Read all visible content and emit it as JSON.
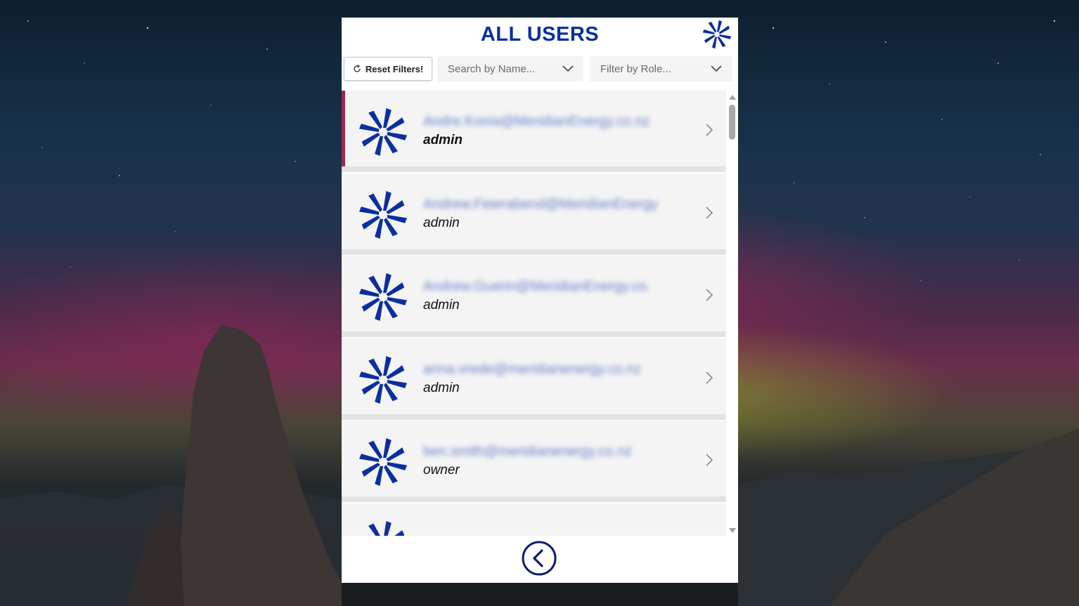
{
  "header": {
    "title": "ALL USERS",
    "logo_icon": "meridian-pinwheel-icon"
  },
  "filters": {
    "reset_label": "Reset Filters!",
    "reset_icon": "refresh-icon",
    "search_placeholder": "Search by Name...",
    "role_placeholder": "Filter by Role..."
  },
  "users": [
    {
      "email": "Andre.Konia@MeridianEnergy.co.nz",
      "role": "admin",
      "selected": true
    },
    {
      "email": "Andrew.Feierabend@MeridianEnergy",
      "role": "admin",
      "selected": false
    },
    {
      "email": "Andrew.Guerin@MeridianEnergy.co.",
      "role": "admin",
      "selected": false
    },
    {
      "email": "anna.vrede@meridianenergy.co.nz",
      "role": "admin",
      "selected": false
    },
    {
      "email": "ben.smith@meridianenergy.co.nz",
      "role": "owner",
      "selected": false
    },
    {
      "email": "",
      "role": "",
      "selected": false
    }
  ],
  "footer": {
    "back_icon": "back-arrow-circle-icon"
  },
  "colors": {
    "brand_blue": "#0b2fa0",
    "selected_accent": "#9a2c4a",
    "list_background": "#f4f4f4",
    "list_divider": "#e3e3e3"
  }
}
